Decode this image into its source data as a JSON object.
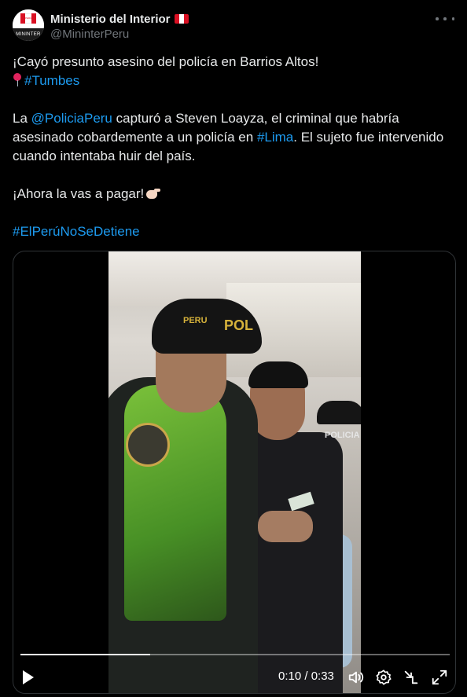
{
  "author": {
    "display_name": "Ministerio del Interior",
    "handle": "@MininterPeru",
    "avatar_text_top": "PERÚ",
    "avatar_text_bottom": "MININTER"
  },
  "tweet": {
    "line1": "¡Cayó presunto asesino del policía en Barrios Altos!",
    "line2_hashtag": "#Tumbes",
    "p2_part1": "La ",
    "p2_mention": "@PoliciaPeru",
    "p2_part2": " capturó a Steven Loayza, el criminal que habría",
    "p2_line2a": "asesinado cobardemente a un policía en ",
    "p2_hashtag": "#Lima",
    "p2_line2b": ". El sujeto fue intervenido",
    "p2_line3": "cuando intentaba huir del país.",
    "p3": "¡Ahora la vas a pagar!",
    "hashtag_final": "#ElPerúNoSeDetiene"
  },
  "video": {
    "time_label": "0:10 / 0:33",
    "progress_fraction": 0.303,
    "cap_text_1": "PERU",
    "cap_text_2": "POL",
    "back_text": "POLICIA"
  },
  "colors": {
    "link": "#1d9bf0",
    "flag_red": "#d91023",
    "text": "#e7e9ea",
    "muted": "#71767b"
  }
}
